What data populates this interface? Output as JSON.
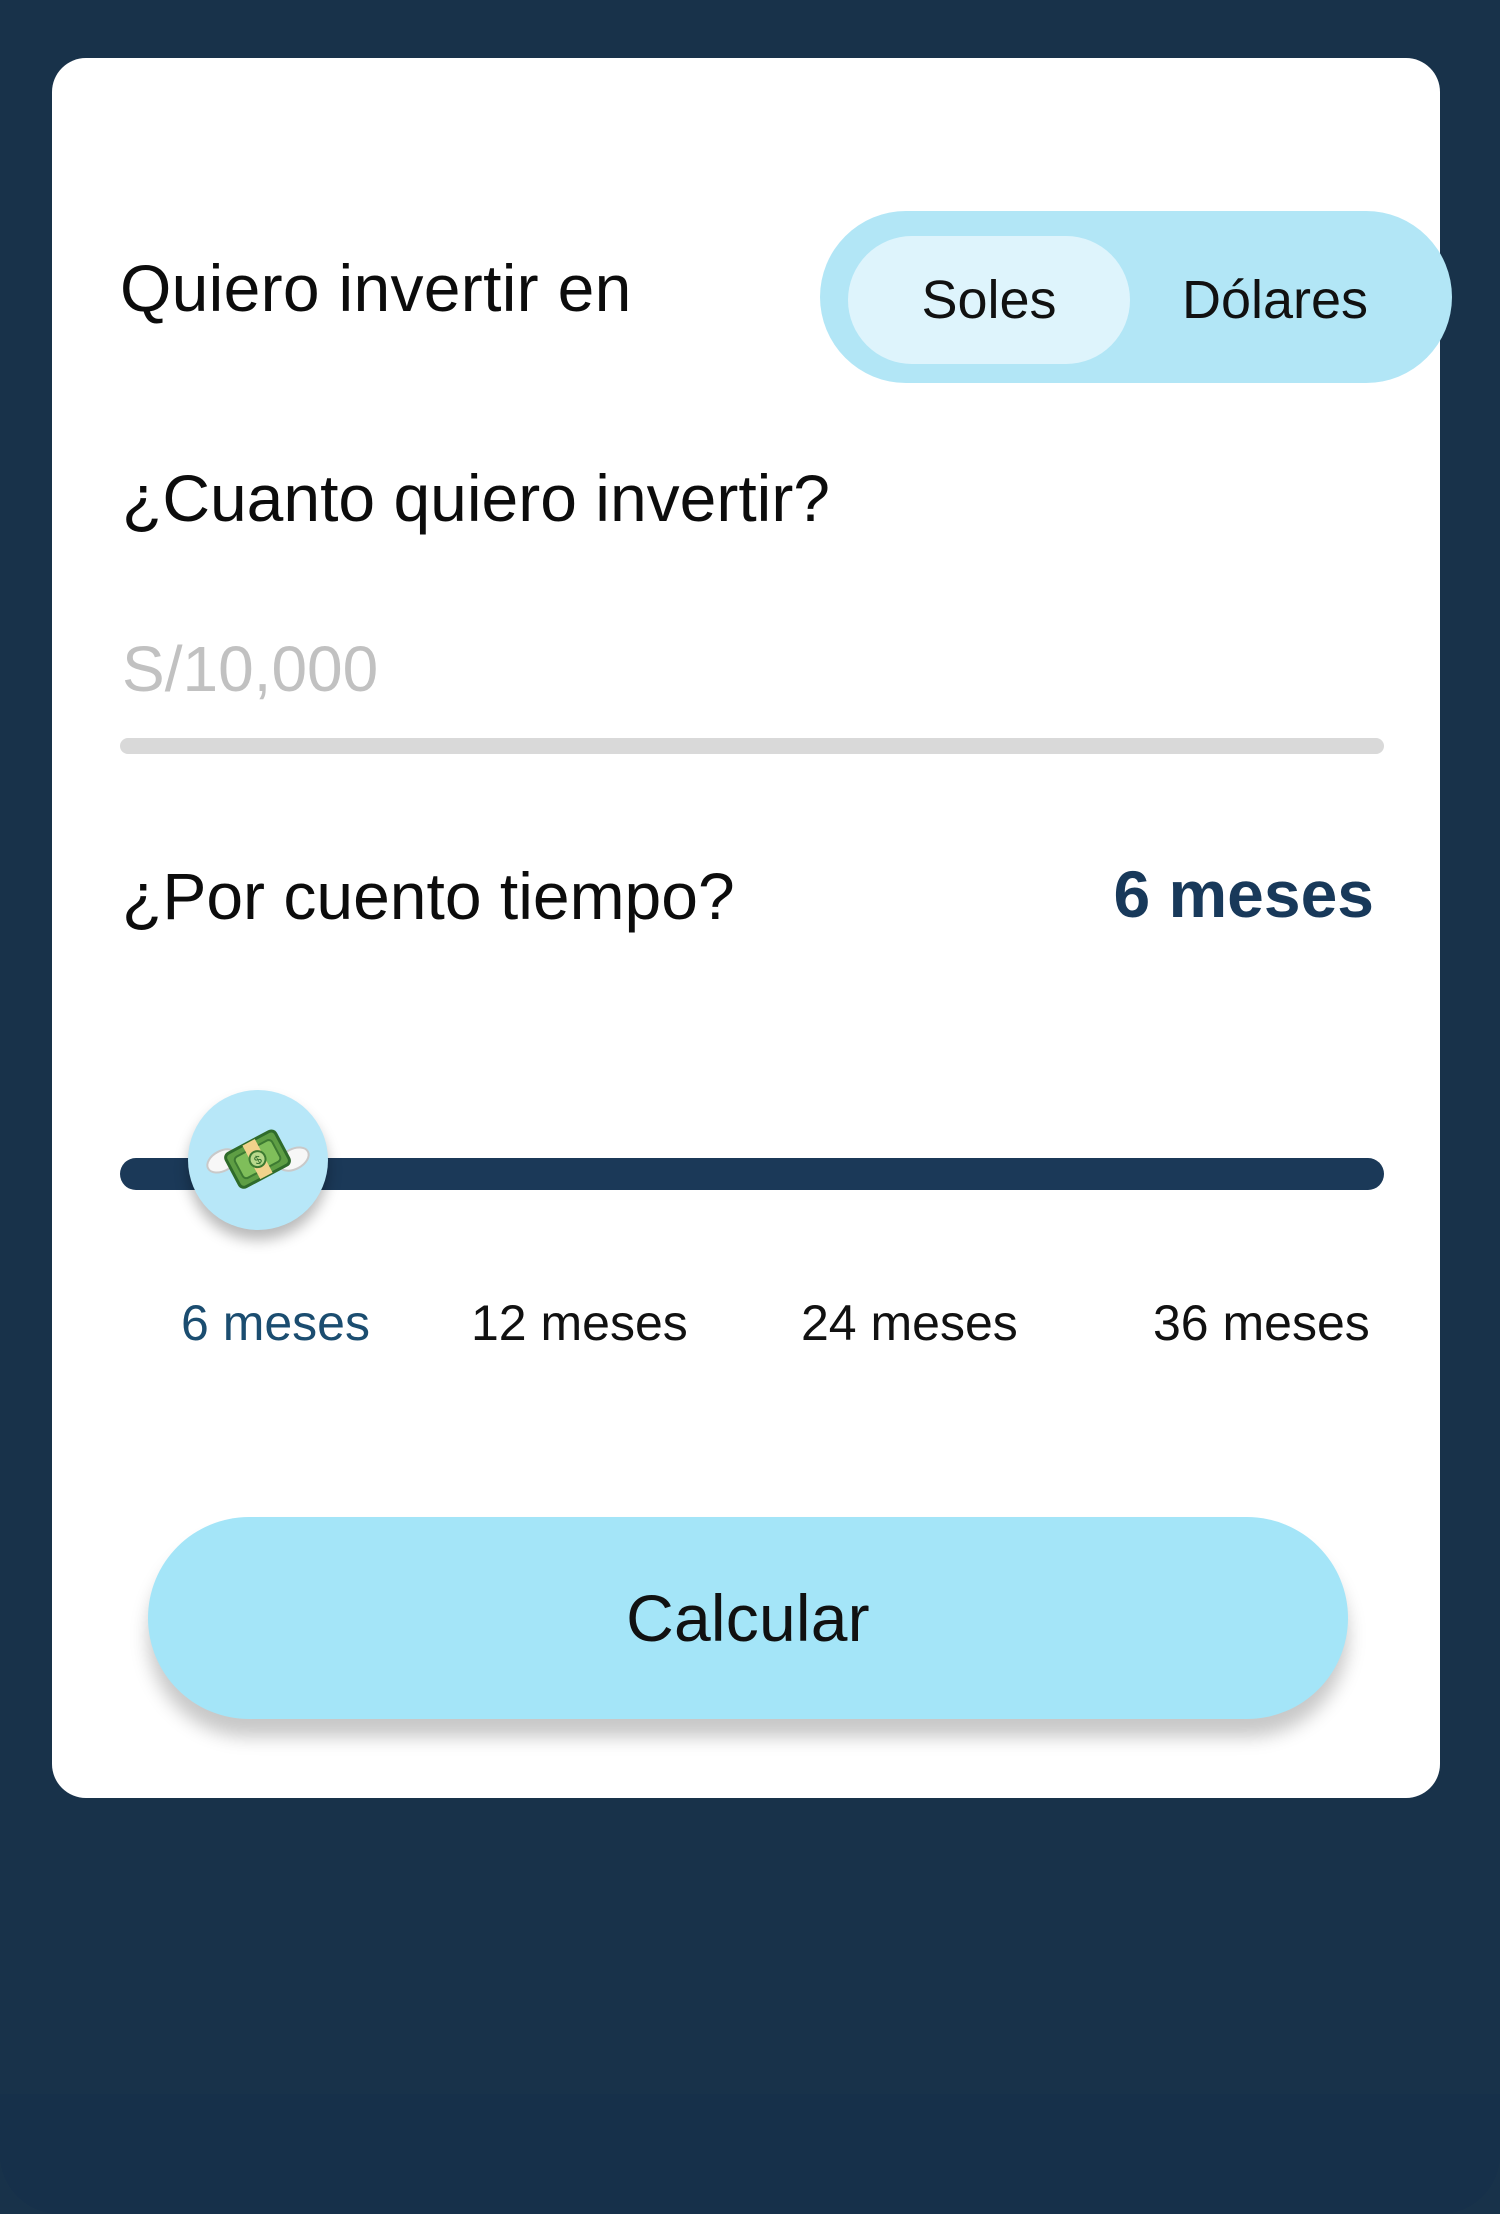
{
  "form": {
    "currency_label": "Quiero invertir en",
    "currency_options": [
      "Soles",
      "Dólares"
    ],
    "currency_selected": "Soles",
    "amount_label": "¿Cuanto quiero invertir?",
    "amount_placeholder": "S/10,000",
    "term_label": "¿Por cuento tiempo?",
    "term_selected": "6 meses",
    "term_options": [
      "6 meses",
      "12 meses",
      "24 meses",
      "36 meses"
    ],
    "term_slider_fraction": 0
  },
  "actions": {
    "calculate": "Calcular"
  },
  "colors": {
    "background": "#18324a",
    "card": "#ffffff",
    "toggle_bg": "#b2e6f6",
    "toggle_selected": "#def4fc",
    "accent_dark": "#1b3958",
    "button": "#a4e5f8"
  },
  "icons": {
    "slider_thumb": "money-with-wings-icon"
  }
}
